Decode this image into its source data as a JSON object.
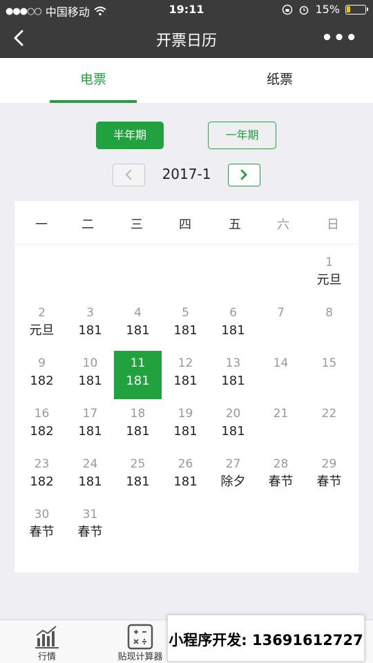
{
  "status": {
    "carrier": "中国移动",
    "signal_dots": "●●●○○",
    "time": "19:11",
    "battery": "15%"
  },
  "nav": {
    "title": "开票日历",
    "more": "•••"
  },
  "tabs": [
    {
      "label": "电票",
      "active": true
    },
    {
      "label": "纸票",
      "active": false
    }
  ],
  "period": {
    "half": "半年期",
    "year": "一年期",
    "selected": "半年期"
  },
  "month": {
    "label": "2017-1",
    "prev": "<",
    "next": ">"
  },
  "calendar": {
    "weekdays": [
      "一",
      "二",
      "三",
      "四",
      "五",
      "六",
      "日"
    ],
    "days": [
      {
        "num": "1",
        "val": "元旦"
      },
      {
        "num": "2",
        "val": "元旦"
      },
      {
        "num": "3",
        "val": "181"
      },
      {
        "num": "4",
        "val": "181"
      },
      {
        "num": "5",
        "val": "181"
      },
      {
        "num": "6",
        "val": "181"
      },
      {
        "num": "7",
        "val": ""
      },
      {
        "num": "8",
        "val": ""
      },
      {
        "num": "9",
        "val": "182"
      },
      {
        "num": "10",
        "val": "181"
      },
      {
        "num": "11",
        "val": "181",
        "selected": true
      },
      {
        "num": "12",
        "val": "181"
      },
      {
        "num": "13",
        "val": "181"
      },
      {
        "num": "14",
        "val": ""
      },
      {
        "num": "15",
        "val": ""
      },
      {
        "num": "16",
        "val": "182"
      },
      {
        "num": "17",
        "val": "181"
      },
      {
        "num": "18",
        "val": "181"
      },
      {
        "num": "19",
        "val": "181"
      },
      {
        "num": "20",
        "val": "181"
      },
      {
        "num": "21",
        "val": ""
      },
      {
        "num": "22",
        "val": ""
      },
      {
        "num": "23",
        "val": "182"
      },
      {
        "num": "24",
        "val": "181"
      },
      {
        "num": "25",
        "val": "181"
      },
      {
        "num": "26",
        "val": "181"
      },
      {
        "num": "27",
        "val": "除夕"
      },
      {
        "num": "28",
        "val": "春节"
      },
      {
        "num": "29",
        "val": "春节"
      },
      {
        "num": "30",
        "val": "春节"
      },
      {
        "num": "31",
        "val": "春节"
      }
    ]
  },
  "tabbar": {
    "items": [
      {
        "label": "行情",
        "icon": "chart-icon"
      },
      {
        "label": "贴现计算器",
        "icon": "calculator-icon"
      }
    ]
  },
  "promo": {
    "text": "小程序开发: 13691612727"
  },
  "colors": {
    "accent": "#21a23e",
    "header": "#3b3b3b",
    "background": "#eeeef3"
  }
}
